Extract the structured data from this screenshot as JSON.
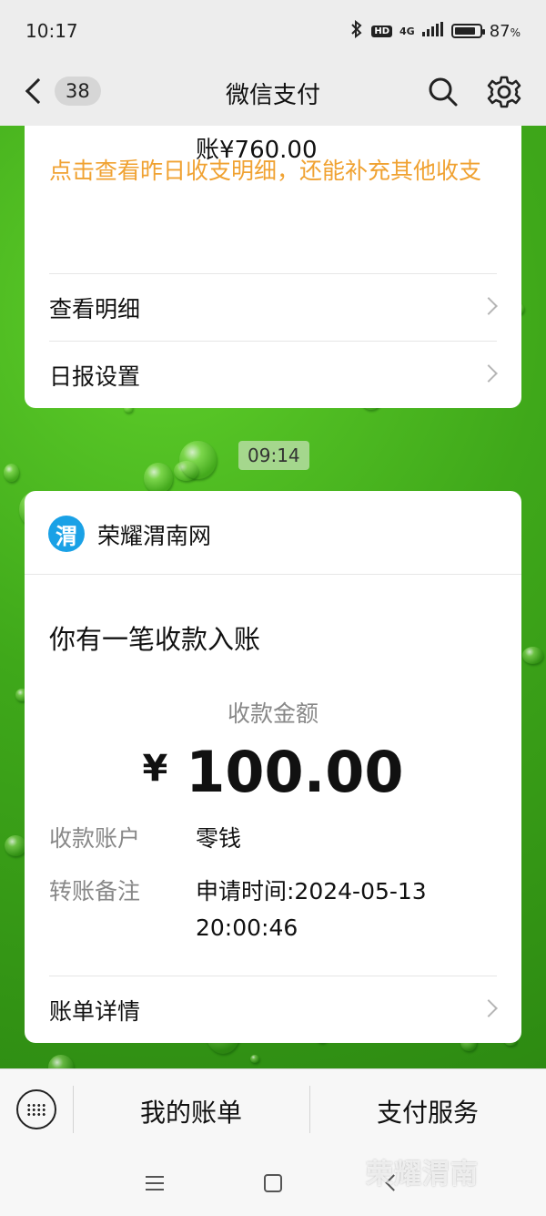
{
  "status_bar": {
    "time": "10:17",
    "network": "4G",
    "battery_level": 87,
    "battery_percent": "87",
    "battery_unit": "%",
    "icons": [
      "bluetooth-icon",
      "hd-icon",
      "signal-icon",
      "battery-icon"
    ]
  },
  "header": {
    "back_count": "38",
    "title": "微信支付",
    "icons": [
      "back-icon",
      "search-icon",
      "settings-icon"
    ]
  },
  "daily_report_card": {
    "partial_line": "账¥760.00",
    "prompt": "点击查看昨日收支明细，还能补充其他收支",
    "rows": [
      "查看明细",
      "日报设置"
    ]
  },
  "timestamp": "09:14",
  "payment_card": {
    "merchant_logo_char": "渭",
    "merchant": "荣耀渭南网",
    "title": "你有一笔收款入账",
    "amount_label": "收款金额",
    "currency": "¥",
    "amount": "100.00",
    "account_label": "收款账户",
    "account_value": "零钱",
    "note_label": "转账备注",
    "note_value": "申请时间:2024-05-13 20:00:46",
    "details_row": "账单详情"
  },
  "bottom_menu": {
    "items": [
      "我的账单",
      "支付服务"
    ]
  },
  "watermark": "荣耀渭南",
  "colors": {
    "accent_orange": "#f0a232",
    "logo_blue": "#1aa1e6",
    "chat_green": "#3fa81a"
  }
}
